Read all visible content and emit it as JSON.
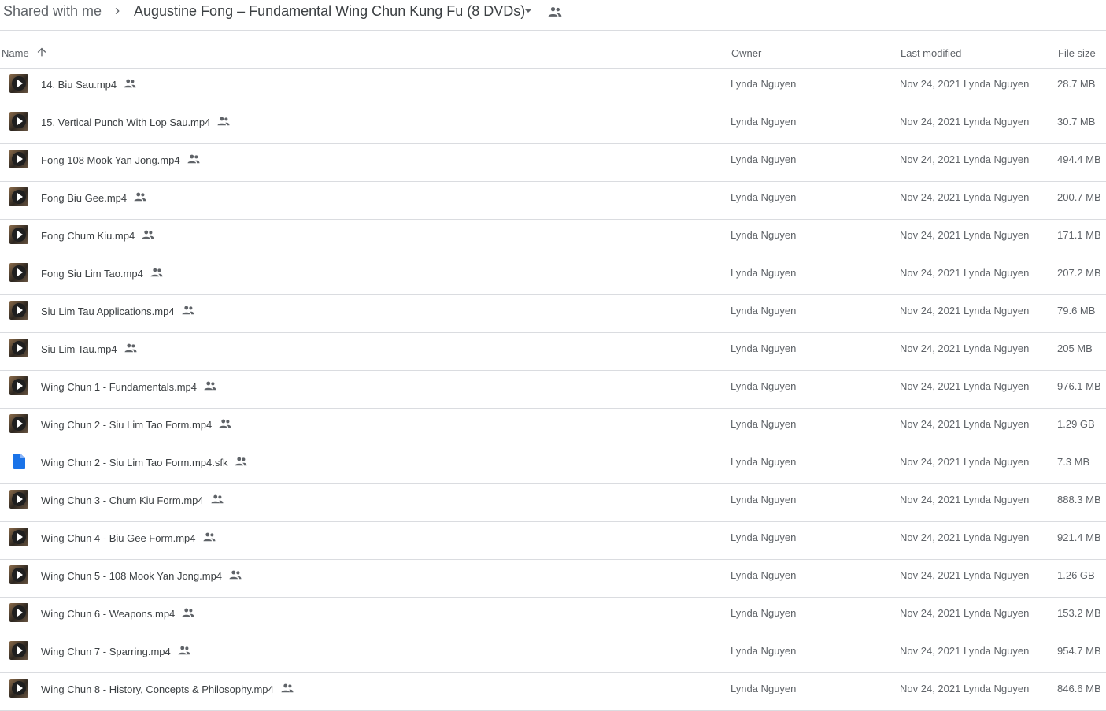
{
  "breadcrumb": {
    "root": "Shared with me",
    "current": "Augustine Fong – Fundamental Wing Chun Kung Fu (8 DVDs)"
  },
  "columns": {
    "name": "Name",
    "owner": "Owner",
    "last_modified": "Last modified",
    "file_size": "File size"
  },
  "files": [
    {
      "name": "14. Biu Sau.mp4",
      "icon": "video-thumbnail-icon",
      "owner": "Lynda Nguyen",
      "modified_date": "Nov 24, 2021",
      "modified_by": "Lynda Nguyen",
      "size": "28.7 MB"
    },
    {
      "name": "15. Vertical Punch With Lop Sau.mp4",
      "icon": "video-thumbnail-icon",
      "owner": "Lynda Nguyen",
      "modified_date": "Nov 24, 2021",
      "modified_by": "Lynda Nguyen",
      "size": "30.7 MB"
    },
    {
      "name": "Fong 108 Mook Yan Jong.mp4",
      "icon": "video-thumbnail-icon",
      "owner": "Lynda Nguyen",
      "modified_date": "Nov 24, 2021",
      "modified_by": "Lynda Nguyen",
      "size": "494.4 MB"
    },
    {
      "name": "Fong Biu Gee.mp4",
      "icon": "video-thumbnail-icon",
      "owner": "Lynda Nguyen",
      "modified_date": "Nov 24, 2021",
      "modified_by": "Lynda Nguyen",
      "size": "200.7 MB"
    },
    {
      "name": "Fong Chum Kiu.mp4",
      "icon": "video-thumbnail-icon",
      "owner": "Lynda Nguyen",
      "modified_date": "Nov 24, 2021",
      "modified_by": "Lynda Nguyen",
      "size": "171.1 MB"
    },
    {
      "name": "Fong Siu Lim Tao.mp4",
      "icon": "video-thumbnail-icon",
      "owner": "Lynda Nguyen",
      "modified_date": "Nov 24, 2021",
      "modified_by": "Lynda Nguyen",
      "size": "207.2 MB"
    },
    {
      "name": "Siu Lim Tau Applications.mp4",
      "icon": "video-thumbnail-icon",
      "owner": "Lynda Nguyen",
      "modified_date": "Nov 24, 2021",
      "modified_by": "Lynda Nguyen",
      "size": "79.6 MB"
    },
    {
      "name": "Siu Lim Tau.mp4",
      "icon": "video-thumbnail-icon",
      "owner": "Lynda Nguyen",
      "modified_date": "Nov 24, 2021",
      "modified_by": "Lynda Nguyen",
      "size": "205 MB"
    },
    {
      "name": "Wing Chun 1 - Fundamentals.mp4",
      "icon": "video-thumbnail-icon",
      "owner": "Lynda Nguyen",
      "modified_date": "Nov 24, 2021",
      "modified_by": "Lynda Nguyen",
      "size": "976.1 MB"
    },
    {
      "name": "Wing Chun 2 - Siu Lim Tao Form.mp4",
      "icon": "video-thumbnail-icon",
      "owner": "Lynda Nguyen",
      "modified_date": "Nov 24, 2021",
      "modified_by": "Lynda Nguyen",
      "size": "1.29 GB"
    },
    {
      "name": "Wing Chun 2 - Siu Lim Tao Form.mp4.sfk",
      "icon": "document-icon",
      "owner": "Lynda Nguyen",
      "modified_date": "Nov 24, 2021",
      "modified_by": "Lynda Nguyen",
      "size": "7.3 MB"
    },
    {
      "name": "Wing Chun 3 - Chum Kiu Form.mp4",
      "icon": "video-thumbnail-icon",
      "owner": "Lynda Nguyen",
      "modified_date": "Nov 24, 2021",
      "modified_by": "Lynda Nguyen",
      "size": "888.3 MB"
    },
    {
      "name": "Wing Chun 4 - Biu Gee Form.mp4",
      "icon": "video-thumbnail-icon",
      "owner": "Lynda Nguyen",
      "modified_date": "Nov 24, 2021",
      "modified_by": "Lynda Nguyen",
      "size": "921.4 MB"
    },
    {
      "name": "Wing Chun 5 - 108 Mook Yan Jong.mp4",
      "icon": "video-thumbnail-icon",
      "owner": "Lynda Nguyen",
      "modified_date": "Nov 24, 2021",
      "modified_by": "Lynda Nguyen",
      "size": "1.26 GB"
    },
    {
      "name": "Wing Chun 6 - Weapons.mp4",
      "icon": "video-thumbnail-icon",
      "owner": "Lynda Nguyen",
      "modified_date": "Nov 24, 2021",
      "modified_by": "Lynda Nguyen",
      "size": "153.2 MB"
    },
    {
      "name": "Wing Chun 7 - Sparring.mp4",
      "icon": "video-thumbnail-icon",
      "owner": "Lynda Nguyen",
      "modified_date": "Nov 24, 2021",
      "modified_by": "Lynda Nguyen",
      "size": "954.7 MB"
    },
    {
      "name": "Wing Chun 8 - History, Concepts & Philosophy.mp4",
      "icon": "video-thumbnail-icon",
      "owner": "Lynda Nguyen",
      "modified_date": "Nov 24, 2021",
      "modified_by": "Lynda Nguyen",
      "size": "846.6 MB"
    }
  ],
  "colors": {
    "text_primary": "#3c4043",
    "text_secondary": "#5f6368",
    "divider": "#dadce0",
    "doc_icon_blue": "#1a73e8"
  }
}
